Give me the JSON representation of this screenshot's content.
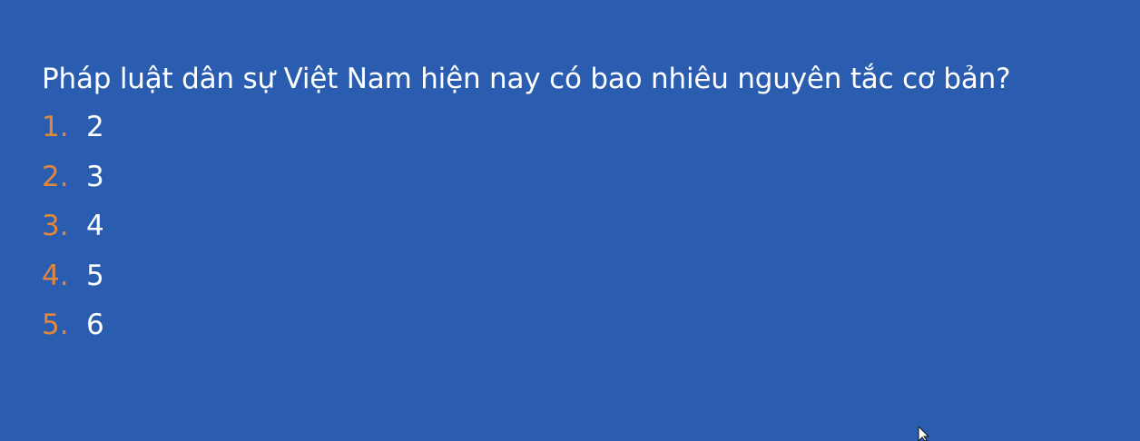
{
  "slide": {
    "question": "Pháp luật dân sự Việt Nam hiện nay có bao nhiêu nguyên tắc cơ bản?",
    "options": [
      {
        "number": "1.",
        "value": "2"
      },
      {
        "number": "2.",
        "value": "3"
      },
      {
        "number": "3.",
        "value": "4"
      },
      {
        "number": "4.",
        "value": "5"
      },
      {
        "number": "5.",
        "value": "6"
      }
    ]
  },
  "colors": {
    "background": "#2a5db0",
    "text": "#ffffff",
    "number_accent": "#e0873b"
  },
  "icons": {
    "cursor": "mouse-pointer-icon"
  }
}
